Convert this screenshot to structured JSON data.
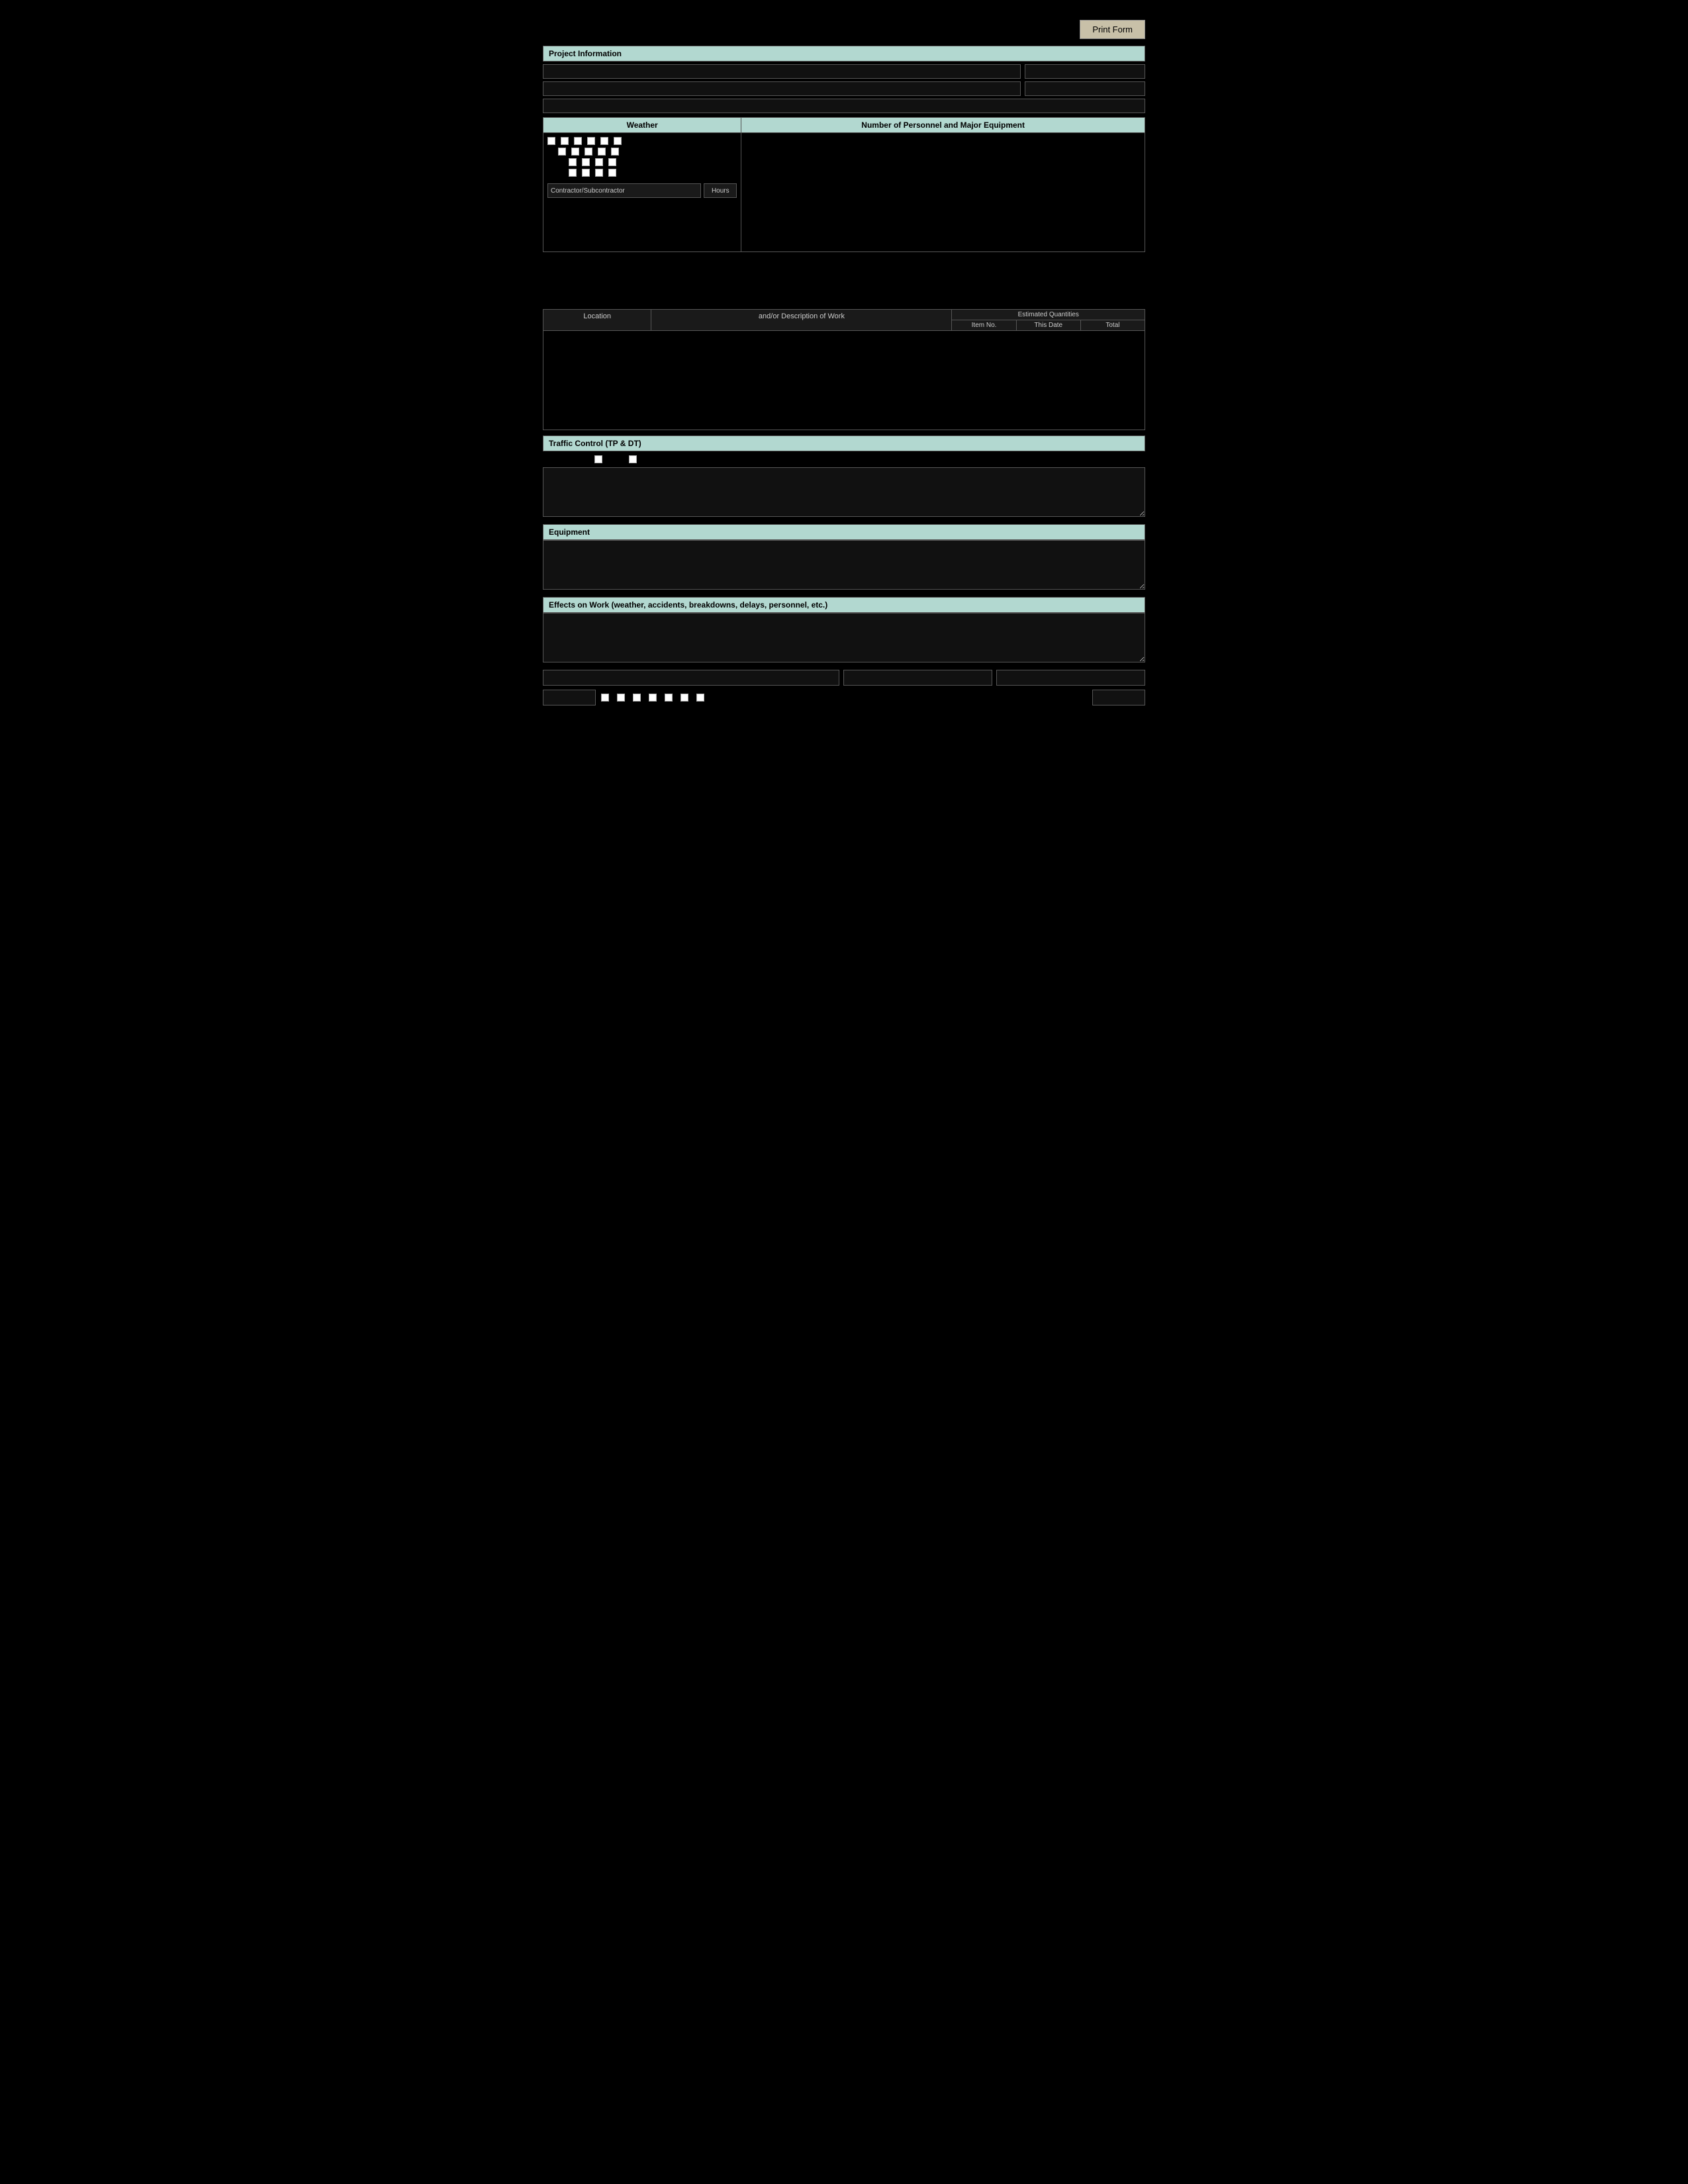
{
  "header": {
    "print_button": "Print Form"
  },
  "project_info": {
    "section_label": "Project Information",
    "field1_placeholder": "",
    "field1_side_placeholder": "",
    "field2_placeholder": "",
    "field2_side_placeholder": "",
    "field3_placeholder": ""
  },
  "weather": {
    "col_left_label": "Weather",
    "col_right_label": "Number of Personnel and Major Equipment",
    "checkboxes_row1": [
      "",
      "",
      "",
      "",
      "",
      ""
    ],
    "checkboxes_row2": [
      "",
      "",
      "",
      "",
      ""
    ],
    "checkboxes_row3": [
      "",
      "",
      "",
      "",
      ""
    ],
    "checkboxes_row4": [
      "",
      "",
      "",
      "",
      ""
    ],
    "contractor_label": "Contractor/Subcontractor",
    "hours_label": "Hours"
  },
  "work_section": {
    "col_location": "Location",
    "col_desc": "and/or Description of Work",
    "col_est": "Estimated Quantities",
    "col_item_no": "Item No.",
    "col_this_date": "This Date",
    "col_total": "Total"
  },
  "traffic_control": {
    "section_label": "Traffic Control (TP & DT)",
    "checkbox1_label": "",
    "checkbox2_label": "",
    "textarea_placeholder": ""
  },
  "equipment": {
    "section_label": "Equipment",
    "textarea_placeholder": ""
  },
  "effects": {
    "section_label": "Effects on Work (weather, accidents, breakdowns, delays, personnel, etc.)",
    "textarea_placeholder": ""
  },
  "signatures": {
    "sig1_placeholder": "",
    "sig2_placeholder": "",
    "sig3_placeholder": "",
    "bottom_input_placeholder": "",
    "checkboxes": [
      "",
      "",
      "",
      "",
      "",
      "",
      ""
    ],
    "end_input_placeholder": ""
  }
}
